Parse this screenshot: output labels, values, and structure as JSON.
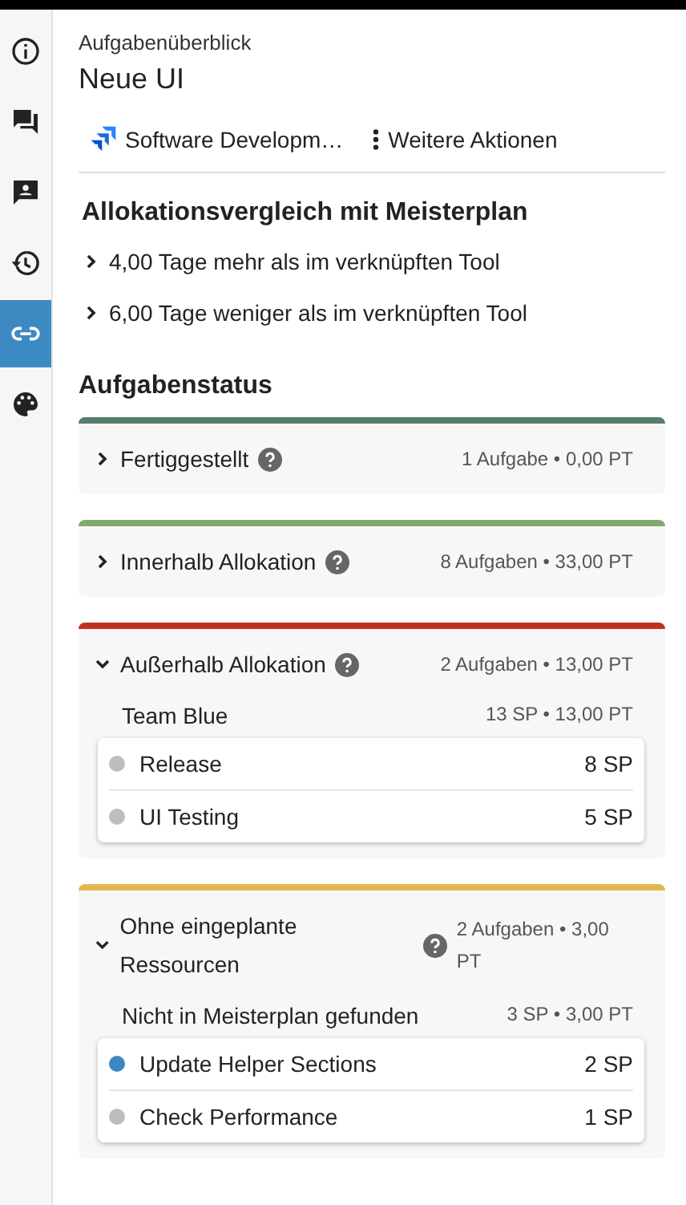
{
  "rail": [
    {
      "selected": false
    },
    {
      "selected": false
    },
    {
      "selected": false
    },
    {
      "selected": false
    },
    {
      "selected": true
    },
    {
      "selected": false
    }
  ],
  "header": {
    "subtitle": "Aufgabenüberblick",
    "title": "Neue UI"
  },
  "actions": [
    {
      "kind": "project",
      "label": "Software Developm…"
    },
    {
      "kind": "more",
      "label": "Weitere Aktionen"
    }
  ],
  "comparison": {
    "title": "Allokationsvergleich mit Meisterplan",
    "rows": [
      {
        "text": "4,00 Tage mehr als im verknüpften Tool",
        "expanded": false
      },
      {
        "text": "6,00 Tage weniger als im verknüpften Tool",
        "expanded": false
      }
    ]
  },
  "status": {
    "title": "Aufgabenstatus",
    "groups": [
      {
        "title": "Fertiggestellt",
        "summary": "1 Aufgabe • 0,00 PT",
        "color": "#557d6a",
        "expanded": false
      },
      {
        "title": "Innerhalb Allokation",
        "summary": "8 Aufgaben • 33,00 PT",
        "color": "#85a86f",
        "expanded": false
      },
      {
        "title": "Außerhalb Allokation",
        "summary": "2 Aufgaben • 13,00 PT",
        "color": "#c0321e",
        "expanded": true,
        "teams": [
          {
            "name": "Team Blue",
            "summary": "13 SP • 13,00 PT",
            "tasks": [
              {
                "name": "Release",
                "points": "8 SP",
                "color": "#bdbdbd"
              },
              {
                "name": "UI Testing",
                "points": "5 SP",
                "color": "#bdbdbd"
              }
            ]
          }
        ]
      },
      {
        "title": "Ohne eingeplante Ressourcen",
        "summary": "2 Aufgaben • 3,00 PT",
        "color": "#e3b94f",
        "expanded": true,
        "teams": [
          {
            "name": "Nicht in Meisterplan gefunden",
            "summary": "3 SP • 3,00 PT",
            "tasks": [
              {
                "name": "Update Helper Sections",
                "points": "2 SP",
                "color": "#3b87c4"
              },
              {
                "name": "Check Performance",
                "points": "1 SP",
                "color": "#bdbdbd"
              }
            ]
          }
        ]
      }
    ]
  }
}
